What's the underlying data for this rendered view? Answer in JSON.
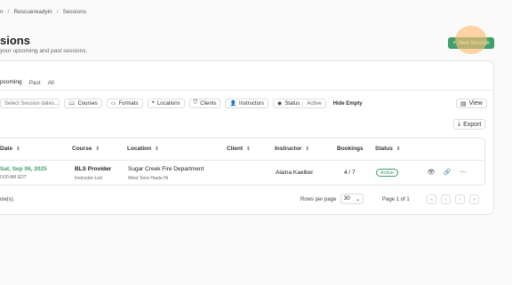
{
  "breadcrumb": {
    "items": [
      "n",
      "Rescuereadyin",
      "Sessions"
    ]
  },
  "header": {
    "title": "sions",
    "subtitle": "your upcoming and past sessions.",
    "new_button_label": "New Session"
  },
  "tabs": [
    {
      "label": "pcoming",
      "active": true
    },
    {
      "label": "Past",
      "active": false
    },
    {
      "label": "All",
      "active": false
    }
  ],
  "filters": {
    "date_placeholder": "Select Session dates...",
    "courses": "Courses",
    "formats": "Formats",
    "locations": "Locations",
    "clients": "Clients",
    "instructors": "Instructors",
    "status": "Status",
    "status_value": "Active",
    "hide_empty": "Hide Empty",
    "view": "View",
    "export": "Export"
  },
  "table": {
    "columns": [
      "Date",
      "Course",
      "Location",
      "Client",
      "Instructor",
      "Bookings",
      "Status"
    ],
    "rows": [
      {
        "date": "Sat, Sep 06, 2025",
        "time": "0:00 AM EDT",
        "course": "BLS Provider",
        "format": "Instructor-Led",
        "location": "Sugar Creek Fire Department",
        "city": "West Terre Haute IN",
        "client": "",
        "instructor": "Alaina Kaelber",
        "bookings": "4 / 7",
        "status": "Active"
      }
    ]
  },
  "footer": {
    "rows_selected": "ow(s).",
    "rows_per_page_label": "Rows per page",
    "rows_per_page_value": "30",
    "page_info": "Page 1 of 1"
  },
  "colors": {
    "accent": "#3e9f6c",
    "highlight": "#fcbe78"
  }
}
